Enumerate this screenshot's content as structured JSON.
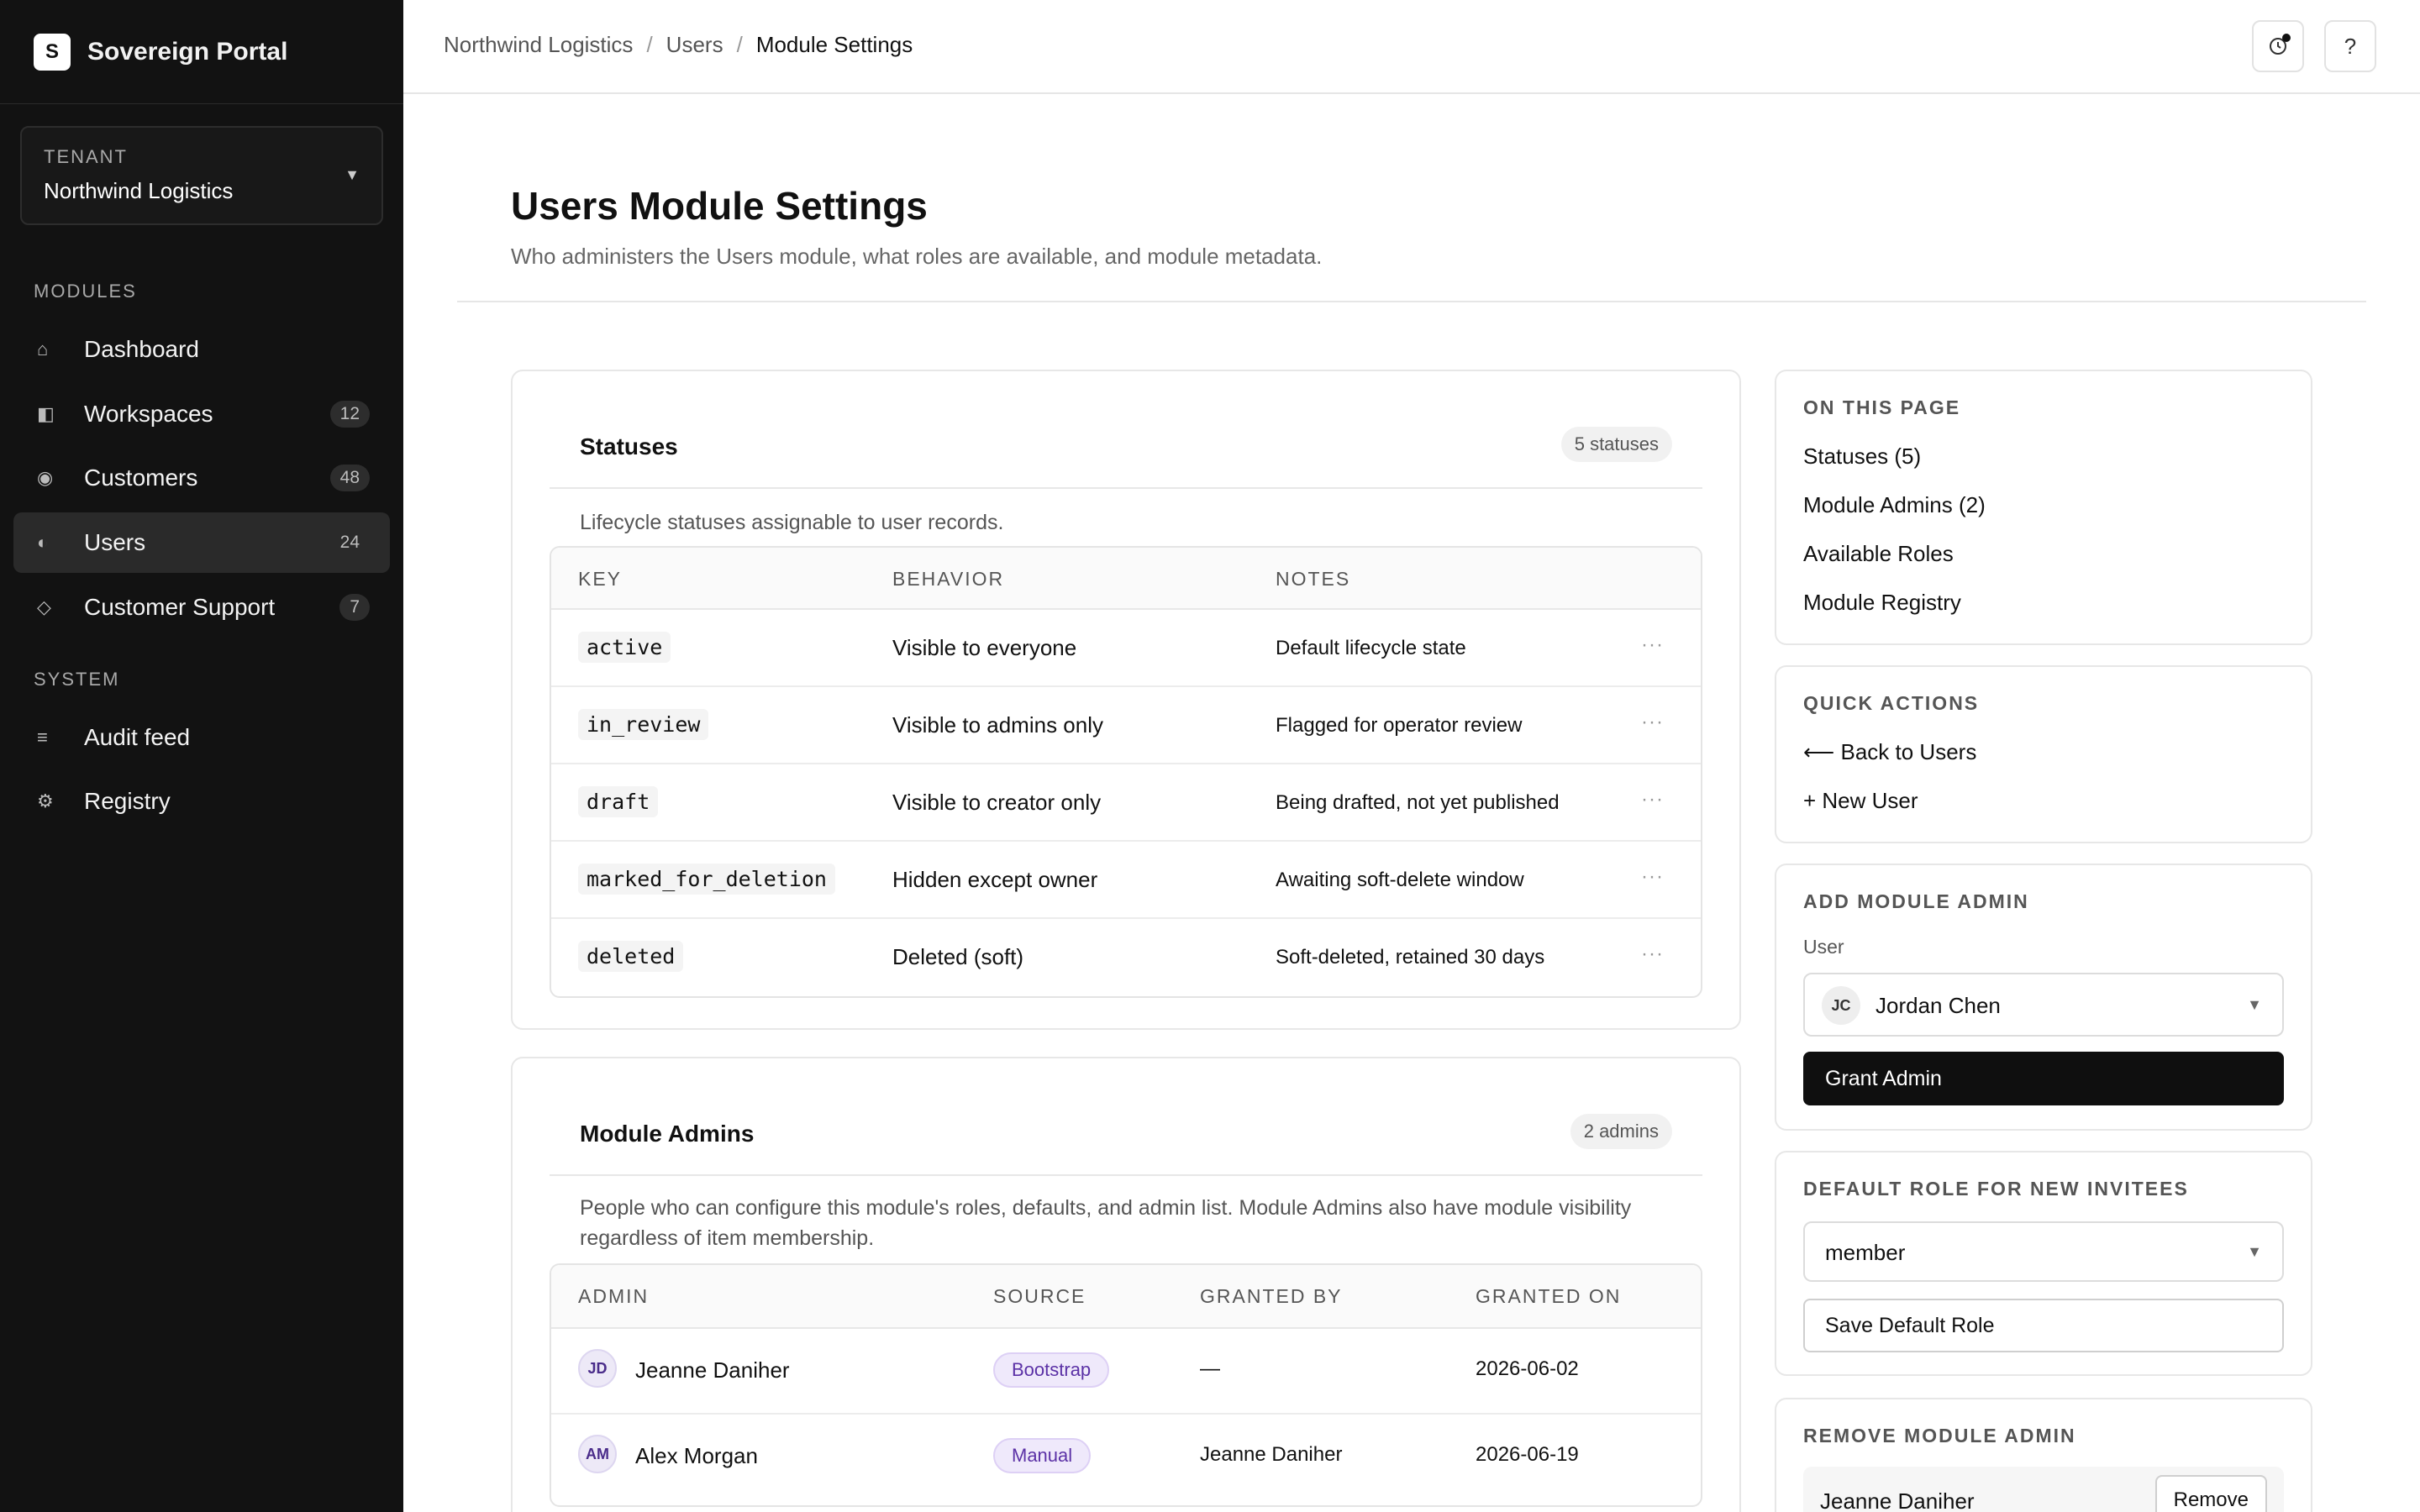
{
  "app": {
    "logo_letter": "S",
    "name": "Sovereign Portal"
  },
  "tenant": {
    "label": "TENANT",
    "value": "Northwind Logistics"
  },
  "sidebar": {
    "modules_label": "MODULES",
    "system_label": "SYSTEM",
    "modules": [
      {
        "label": "Dashboard",
        "icon": "home-icon",
        "glyph": "⌂",
        "count": ""
      },
      {
        "label": "Workspaces",
        "icon": "workspace-icon",
        "glyph": "◧",
        "count": "12"
      },
      {
        "label": "Customers",
        "icon": "customers-icon",
        "glyph": "◉",
        "count": "48"
      },
      {
        "label": "Users",
        "icon": "users-icon",
        "glyph": "◐",
        "count": "24"
      },
      {
        "label": "Customer Support",
        "icon": "support-icon",
        "glyph": "◇",
        "count": "7"
      }
    ],
    "system": [
      {
        "label": "Audit feed",
        "icon": "list-icon",
        "glyph": "≡"
      },
      {
        "label": "Registry",
        "icon": "gear-icon",
        "glyph": "⚙"
      }
    ]
  },
  "breadcrumb": [
    "Northwind Logistics",
    "Users",
    "Module Settings"
  ],
  "page": {
    "title": "Users Module Settings",
    "subtitle": "Who administers the Users module, what roles are available, and module metadata."
  },
  "statuses": {
    "title": "Statuses",
    "badge": "5 statuses",
    "description": "Lifecycle statuses assignable to user records.",
    "columns": [
      "KEY",
      "BEHAVIOR",
      "NOTES"
    ],
    "rows": [
      {
        "key": "active",
        "behavior": "Visible to everyone",
        "notes": "Default lifecycle state"
      },
      {
        "key": "in_review",
        "behavior": "Visible to admins only",
        "notes": "Flagged for operator review"
      },
      {
        "key": "draft",
        "behavior": "Visible to creator only",
        "notes": "Being drafted, not yet published"
      },
      {
        "key": "marked_for_deletion",
        "behavior": "Hidden except owner",
        "notes": "Awaiting soft-delete window"
      },
      {
        "key": "deleted",
        "behavior": "Deleted (soft)",
        "notes": "Soft-deleted, retained 30 days"
      }
    ],
    "more_glyph": "···"
  },
  "admins": {
    "title": "Module Admins",
    "badge": "2 admins",
    "description": "People who can configure this module's roles, defaults, and admin list. Module Admins also have module visibility regardless of item membership.",
    "columns": [
      "ADMIN",
      "SOURCE",
      "GRANTED BY",
      "GRANTED ON"
    ],
    "rows": [
      {
        "initials": "JD",
        "name": "Jeanne Daniher",
        "source": "Bootstrap",
        "granted_by": "—",
        "granted_on": "2026-06-02"
      },
      {
        "initials": "AM",
        "name": "Alex Morgan",
        "source": "Manual",
        "granted_by": "Jeanne Daniher",
        "granted_on": "2026-06-19"
      }
    ]
  },
  "on_this_page": {
    "label": "ON THIS PAGE",
    "links": [
      "Statuses (5)",
      "Module Admins (2)",
      "Available Roles",
      "Module Registry"
    ]
  },
  "quick_actions": {
    "label": "QUICK ACTIONS",
    "back": "⟵ Back to Users",
    "new": "+ New User"
  },
  "add_admin": {
    "label": "ADD MODULE ADMIN",
    "field_label": "User",
    "selected_initials": "JC",
    "selected_user": "Jordan Chen",
    "button": "Grant Admin"
  },
  "default_role": {
    "label": "DEFAULT ROLE FOR NEW INVITEES",
    "selected": "member",
    "button": "Save Default Role"
  },
  "remove_admin": {
    "label": "REMOVE MODULE ADMIN",
    "name": "Jeanne Daniher",
    "button": "Remove"
  },
  "topbar": {
    "history_icon": "history-icon",
    "help_glyph": "?"
  }
}
